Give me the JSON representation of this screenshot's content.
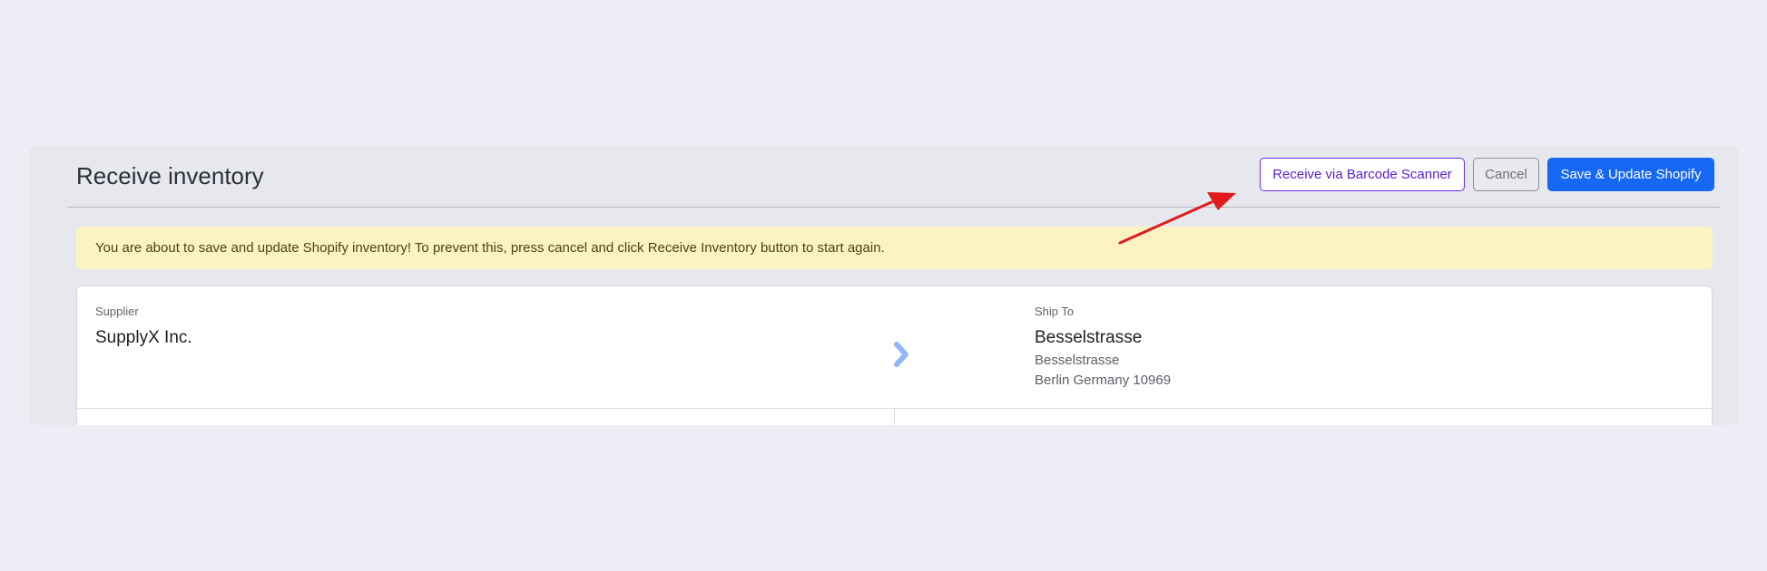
{
  "header": {
    "title": "Receive inventory",
    "barcode_button": "Receive via Barcode Scanner",
    "cancel_button": "Cancel",
    "save_button": "Save & Update Shopify"
  },
  "warning": {
    "message": "You are about to save and update Shopify inventory! To prevent this, press cancel and click Receive Inventory button to start again."
  },
  "supplier": {
    "label": "Supplier",
    "name": "SupplyX Inc."
  },
  "ship_to": {
    "label": "Ship To",
    "name": "Besselstrasse",
    "address_line1": "Besselstrasse",
    "address_line2": "Berlin Germany 10969"
  },
  "icons": {
    "transfer": "chevron-right-icon",
    "annotation": "red-arrow"
  },
  "colors": {
    "page_bg": "#ecedf5",
    "primary": "#1668f2",
    "barcode_accent": "#6a2be0",
    "warning_bg": "#fdf2c2",
    "chevron": "#8fb8f5",
    "annotation_arrow": "#e01b1b"
  }
}
